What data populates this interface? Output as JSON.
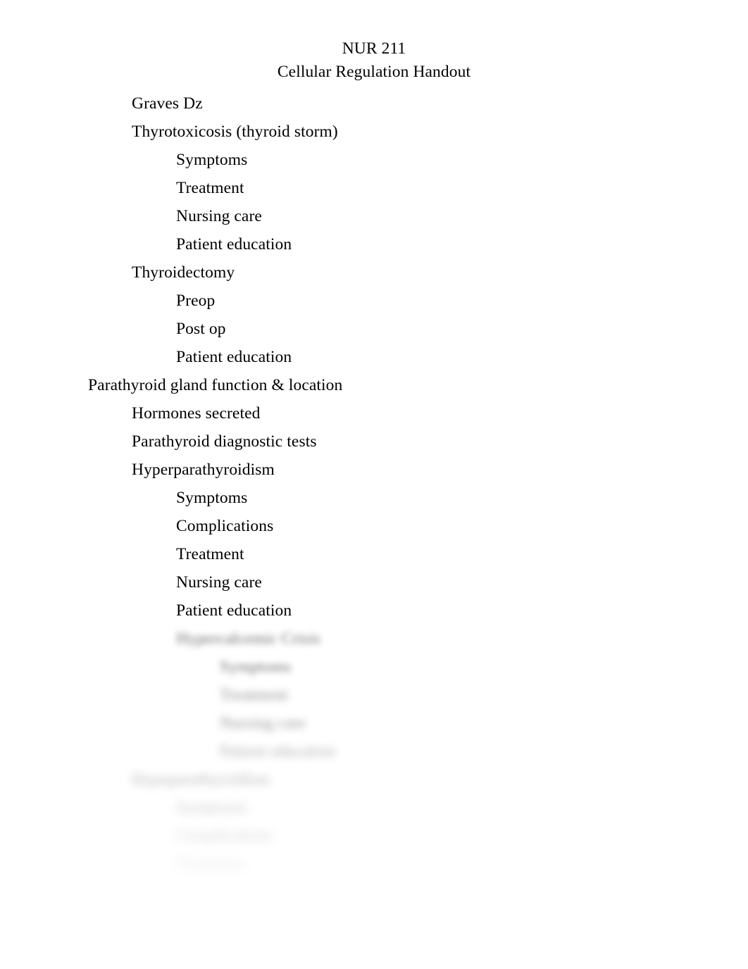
{
  "document": {
    "title_line_1": "NUR 211",
    "title_line_2": "Cellular Regulation Handout",
    "text_color": "#000000",
    "page_background": "#ffffff"
  },
  "outline": [
    {
      "level": 1,
      "text": "Graves Dz",
      "blurred": false
    },
    {
      "level": 1,
      "text": "Thyrotoxicosis (thyroid storm)",
      "blurred": false
    },
    {
      "level": 2,
      "text": "Symptoms",
      "blurred": false
    },
    {
      "level": 2,
      "text": "Treatment",
      "blurred": false
    },
    {
      "level": 2,
      "text": "Nursing care",
      "blurred": false
    },
    {
      "level": 2,
      "text": "Patient education",
      "blurred": false
    },
    {
      "level": 1,
      "text": "Thyroidectomy",
      "blurred": false
    },
    {
      "level": 2,
      "text": "Preop",
      "blurred": false
    },
    {
      "level": 2,
      "text": "Post op",
      "blurred": false
    },
    {
      "level": 2,
      "text": "Patient education",
      "blurred": false
    },
    {
      "level": 0,
      "text": "Parathyroid gland function & location",
      "blurred": false
    },
    {
      "level": 1,
      "text": "Hormones secreted",
      "blurred": false
    },
    {
      "level": 1,
      "text": "Parathyroid diagnostic tests",
      "blurred": false
    },
    {
      "level": 1,
      "text": "Hyperparathyroidism",
      "blurred": false
    },
    {
      "level": 2,
      "text": "Symptoms",
      "blurred": false
    },
    {
      "level": 2,
      "text": "Complications",
      "blurred": false
    },
    {
      "level": 2,
      "text": "Treatment",
      "blurred": false
    },
    {
      "level": 2,
      "text": "Nursing care",
      "blurred": false
    },
    {
      "level": 2,
      "text": "Patient education",
      "blurred": false
    },
    {
      "level": 2,
      "text": "Hypercalcemic Crisis",
      "blurred": true,
      "blur_step": 1
    },
    {
      "level": 3,
      "text": "Symptoms",
      "blurred": true,
      "blur_step": 1
    },
    {
      "level": 3,
      "text": "Treatment",
      "blurred": true,
      "blur_step": 2
    },
    {
      "level": 3,
      "text": "Nursing care",
      "blurred": true,
      "blur_step": 2
    },
    {
      "level": 3,
      "text": "Patient education",
      "blurred": true,
      "blur_step": 3
    },
    {
      "level": 1,
      "text": "Hypoparathyroidism",
      "blurred": true,
      "blur_step": 3
    },
    {
      "level": 2,
      "text": "Symptoms",
      "blurred": true,
      "blur_step": 4
    },
    {
      "level": 2,
      "text": "Complications",
      "blurred": true,
      "blur_step": 4
    },
    {
      "level": 2,
      "text": "Treatment",
      "blurred": true,
      "blur_step": 5
    }
  ]
}
